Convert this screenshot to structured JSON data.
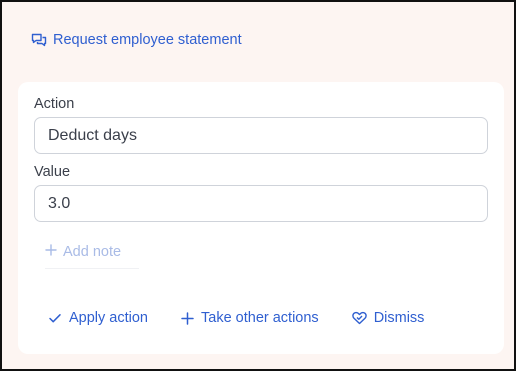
{
  "request_link": {
    "label": "Request employee statement",
    "icon": "chat-bubbles-icon"
  },
  "form": {
    "action": {
      "label": "Action",
      "value": "Deduct days"
    },
    "value": {
      "label": "Value",
      "value": "3.0"
    },
    "add_note": {
      "label": "Add note",
      "icon": "plus-icon"
    }
  },
  "actions": {
    "apply": {
      "label": "Apply action",
      "icon": "check-icon"
    },
    "other": {
      "label": "Take other actions",
      "icon": "plus-icon"
    },
    "dismiss": {
      "label": "Dismiss",
      "icon": "heart-icon"
    }
  },
  "colors": {
    "accent": "#2f5fd0",
    "muted_accent": "#a9bbe6",
    "background": "#fdf5f2",
    "card": "#ffffff"
  }
}
